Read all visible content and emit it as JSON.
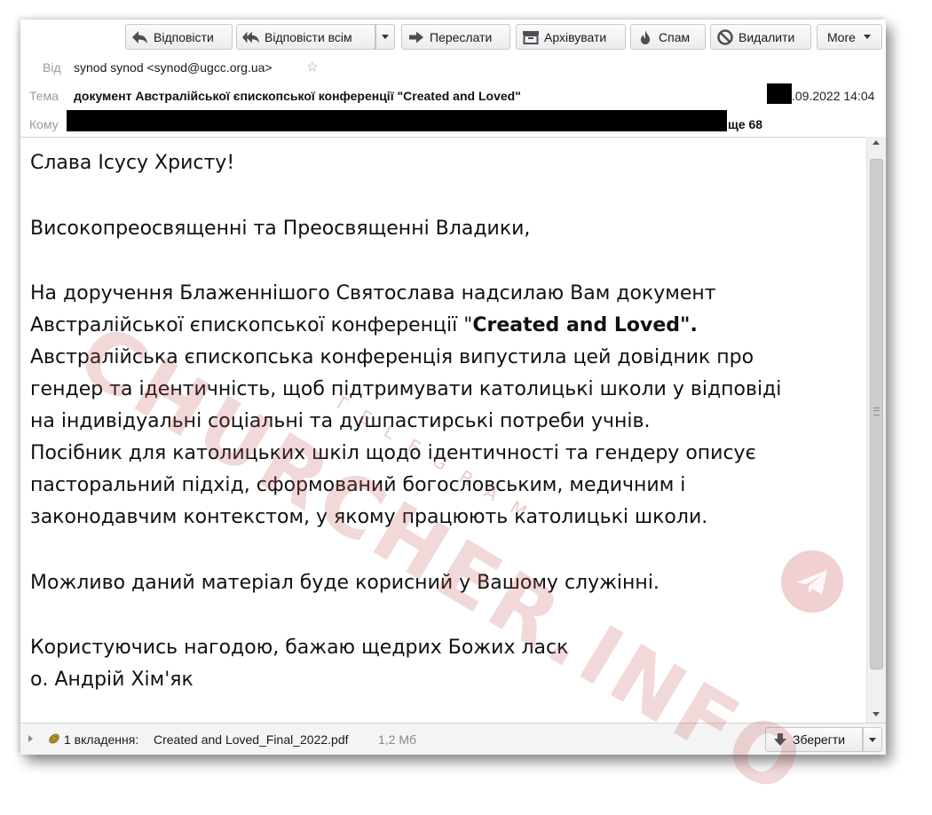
{
  "toolbar": {
    "reply": "Відповісти",
    "reply_all": "Відповісти всім",
    "forward": "Переслати",
    "archive": "Архівувати",
    "spam": "Спам",
    "delete": "Видалити",
    "more": "More"
  },
  "header": {
    "from_label": "Від",
    "from_value": "synod synod <synod@ugcc.org.ua>",
    "subject_label": "Тема",
    "subject_value": "документ Австралійської єпископської конференції \"Created and Loved\"",
    "date_value": ".09.2022 14:04",
    "to_label": "Кому",
    "to_more": "ще 68"
  },
  "body": {
    "line1": "Слава Ісусу Христу!",
    "line2": "Високопреосвященні та Преосвященні Владики,",
    "line3": "На доручення Блаженнішого Святослава надсилаю Вам документ",
    "line4a": "Австралійської єпископської конференції \"",
    "line4b": "Created and Loved\".",
    "line5": "Австралійська єпископська конференція випустила цей довідник про",
    "line6": "гендер та ідентичність, щоб підтримувати католицькі школи у відповіді",
    "line7": "на індивідуальні соціальні та душпастирські потреби учнів.",
    "line8": "Посібник для католицьких шкіл щодо ідентичності та гендеру описує",
    "line9": "пасторальний підхід, сформований богословським, медичним і",
    "line10": "законодавчим контекстом, у якому працюють католицькі школи.",
    "line11": "Можливо даний матеріал буде корисний у Вашому служінні.",
    "line12": "Користуючись нагодою, бажаю щедрих Божих ласк",
    "line13": "о. Андрій Хім'як"
  },
  "attachment": {
    "count_label": "1 вкладення:",
    "filename": "Created and Loved_Final_2022.pdf",
    "size": "1,2 Мб",
    "save_label": "Зберегти"
  },
  "watermark": {
    "text": "CHURCHER.INFO",
    "subtext": "TELEGRAM"
  },
  "icons": {
    "reply": "reply-arrow-icon",
    "reply_all": "reply-all-icon",
    "forward": "forward-arrow-icon",
    "archive": "archive-box-icon",
    "spam": "flame-icon",
    "delete": "ban-circle-icon",
    "star": "star-outline-icon",
    "attachment": "paperclip-icon",
    "save": "download-arrow-icon",
    "watermark_logo": "telegram-plane-icon"
  }
}
